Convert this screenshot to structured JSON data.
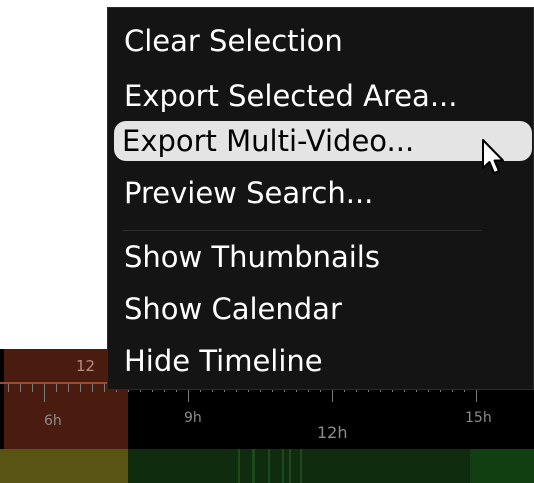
{
  "context_menu": {
    "items": [
      {
        "label": "Clear Selection",
        "highlighted": false
      },
      {
        "label": "Export Selected Area...",
        "highlighted": false
      },
      {
        "label": "Export Multi-Video...",
        "highlighted": true
      },
      {
        "label": "Preview Search...",
        "highlighted": false
      },
      {
        "label": "Show Thumbnails",
        "highlighted": false
      },
      {
        "label": "Show Calendar",
        "highlighted": false
      },
      {
        "label": "Hide Timeline",
        "highlighted": false
      }
    ]
  },
  "timeline": {
    "day_label": "12",
    "hour_labels": [
      "6h",
      "9h",
      "12h",
      "15h"
    ],
    "colors": {
      "selection_background": "#4a1c10",
      "recording_bar": "#0f2c0f",
      "selection_bar": "#5a5414"
    }
  },
  "cursor": {
    "icon": "arrow-pointer-icon"
  }
}
